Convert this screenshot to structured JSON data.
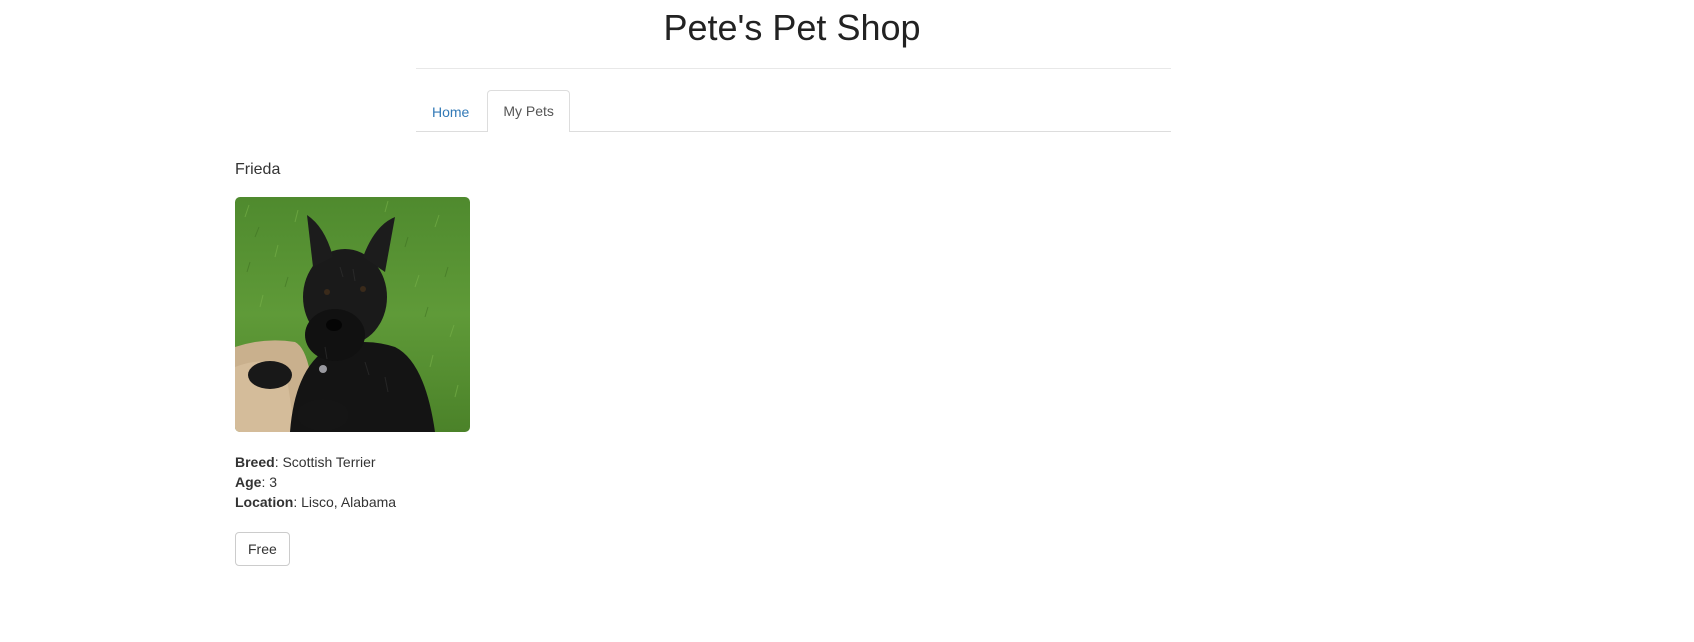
{
  "header": {
    "title": "Pete's Pet Shop"
  },
  "nav": {
    "tabs": [
      {
        "label": "Home",
        "active": false
      },
      {
        "label": "My Pets",
        "active": true
      }
    ]
  },
  "pet": {
    "name": "Frieda",
    "photo_icon": "scottish-terrier-photo",
    "breed_label": "Breed",
    "breed": "Scottish Terrier",
    "age_label": "Age",
    "age": "3",
    "location_label": "Location",
    "location": "Lisco, Alabama",
    "action_label": "Free"
  },
  "colors": {
    "link": "#337ab7",
    "text": "#333333",
    "border": "#dddddd"
  }
}
